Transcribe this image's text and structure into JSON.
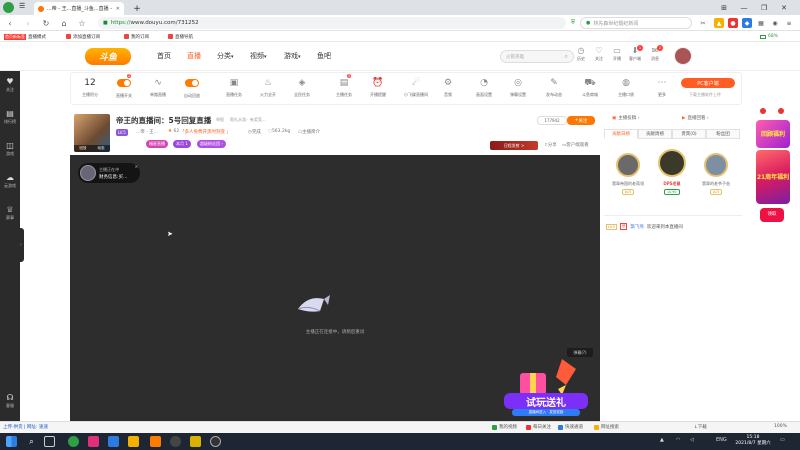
{
  "browser": {
    "tabs": [
      {
        "title": "...帝 - 王...直播_斗鱼...直播 - ...",
        "active": false
      },
      {
        "title": "",
        "active": true
      }
    ],
    "new_tab": "+",
    "window_controls": {
      "pin": "⊞",
      "minimize": "—",
      "restore": "❐",
      "close": "✕"
    },
    "url_scheme": "https://",
    "url_host": "www.douyu.com",
    "url_path": "/731252",
    "search_placeholder": "林先森世纪婚纪新闻",
    "zoom_label": "68%",
    "home_tag": "首页新标签",
    "bookmarks": [
      {
        "label": "直播模式"
      },
      {
        "label": "添加直播订阅"
      },
      {
        "label": "我的订阅"
      },
      {
        "label": "直播导航"
      }
    ]
  },
  "site": {
    "logo_text": "斗鱼",
    "nav": [
      {
        "label": "首页",
        "active": false
      },
      {
        "label": "直播",
        "active": true
      },
      {
        "label": "分类",
        "active": false
      },
      {
        "label": "视频",
        "active": false
      },
      {
        "label": "游戏",
        "active": false
      },
      {
        "label": "鱼吧",
        "active": false
      }
    ],
    "nav_dropdown_marks": [
      "▾",
      "▾",
      "▾"
    ],
    "search_placeholder": "火箭英雄",
    "header_icons": [
      {
        "label": "历史",
        "badge": ""
      },
      {
        "label": "关注",
        "badge": ""
      },
      {
        "label": "开播",
        "badge": ""
      },
      {
        "label": "客户端",
        "badge": "1"
      },
      {
        "label": "消息",
        "badge": "2"
      }
    ]
  },
  "sidebar": {
    "items": [
      {
        "label": "关注",
        "icon": "heart-icon"
      },
      {
        "label": "排行榜",
        "icon": "ranking-icon"
      },
      {
        "label": "游戏",
        "icon": "gamepad-icon"
      },
      {
        "label": "云游戏",
        "icon": "cloud-game-icon"
      },
      {
        "label": "赛事",
        "icon": "trophy-icon"
      },
      {
        "label": "客服",
        "icon": "service-icon"
      }
    ],
    "collapse": "›"
  },
  "toolstrip": {
    "level_num": "12",
    "items": [
      {
        "label": "主播积分",
        "kind": "num"
      },
      {
        "label": "直播开关",
        "kind": "toggle",
        "badge": "2"
      },
      {
        "label": "单路直播",
        "kind": "icon",
        "glyph": "∿"
      },
      {
        "label": "自动回放",
        "kind": "toggle"
      },
      {
        "label": "直播任务",
        "kind": "icon",
        "glyph": "▣"
      },
      {
        "label": "火力全开",
        "kind": "icon",
        "glyph": "♨"
      },
      {
        "label": "全民任务",
        "kind": "icon",
        "glyph": "◈"
      },
      {
        "label": "主播任务",
        "kind": "icon",
        "glyph": "▤",
        "badge": "2"
      },
      {
        "label": "开播提醒",
        "kind": "icon",
        "glyph": "⏰"
      },
      {
        "label": "小飞碟直播间",
        "kind": "icon",
        "glyph": "☄"
      },
      {
        "label": "音频",
        "kind": "icon",
        "glyph": "⚙"
      },
      {
        "label": "画面设置",
        "kind": "icon",
        "glyph": "◔"
      },
      {
        "label": "弹幕设置",
        "kind": "icon",
        "glyph": "◎"
      },
      {
        "label": "发布动态",
        "kind": "icon",
        "glyph": "✎"
      },
      {
        "label": "斗鱼商城",
        "kind": "icon",
        "glyph": "⛟"
      },
      {
        "label": "主播口袋",
        "kind": "icon",
        "glyph": "◍"
      },
      {
        "label": "更多",
        "kind": "icon",
        "glyph": "⋯"
      }
    ],
    "pc_client": "PC客户端",
    "pc_client_sub": "下载主播软件上传"
  },
  "stream": {
    "title": "帝王的直播间：5号回复直播",
    "report": "举报",
    "category": "帮扎水游 · 有奖竞...",
    "level": "LV.5",
    "name": "...帝 · 王...",
    "badge_62": "62",
    "promo_tag": "「多人免费开黑时刻变 」",
    "stat1": "完成",
    "stat2": "563.2kg",
    "stat3": "主播简介",
    "viewers": "177942",
    "follow": "关注",
    "pill1": "福星直播",
    "pill1b": "本月 1",
    "pill2": "超级粉丝团 ›",
    "task": "日程发射 >",
    "share": "分享",
    "client_watch": "客户端观看",
    "thumb_left": "回放",
    "thumb_right": "动态"
  },
  "player": {
    "badge_line1": "主播正在冲",
    "badge_line2": "财务信息:买...",
    "badge_close": "✕",
    "loading": "主播正在连接中，请稍后重试",
    "danmu": "弹幕(?)",
    "promo_label": "试玩送礼",
    "promo_sub": "直播间进入 · 发放奖励"
  },
  "right_panel": {
    "tab1": "主播投稿 ›",
    "tab2": "直播回看 ›",
    "subtabs": [
      {
        "label": "贡献日榜",
        "selected": true
      },
      {
        "label": "贡献周榜",
        "selected": false
      },
      {
        "label": "贵宾(0)",
        "selected": false
      },
      {
        "label": "粉丝团",
        "selected": false
      }
    ],
    "ranks": [
      {
        "name": "翡翠帝国的老蒋翎",
        "level": "LV.5",
        "color": "#6a6a6a"
      },
      {
        "name": "DPS老鼠",
        "level": "LV.90",
        "color": "#3a3a2a"
      },
      {
        "name": "翡翠的老爷子爸",
        "level": "LV.5",
        "color": "#7f8fa3"
      }
    ],
    "welcome_level": "LV.5",
    "welcome_icon": "侠",
    "welcome_user": "飘飞燕",
    "welcome_text": "欢迎来到本直播间"
  },
  "ads": {
    "ad1": "回顾福利",
    "ad2": "21周年福利",
    "ad3": "领取"
  },
  "statusbar": {
    "left": "上传-供货 | 网址: 速速",
    "items": [
      "我的视频",
      "每日关注",
      "快速通道",
      "网址搜索",
      "↓下载",
      "100%"
    ]
  },
  "taskbar": {
    "time": "15:18",
    "date": "2021/8/7 星期六",
    "lang": "ENG"
  },
  "colors": {
    "accent": "#ff5d23",
    "orange": "#ff7700",
    "player_bg": "#2d2d2d",
    "sidebar_bg": "#2b2b2b"
  }
}
